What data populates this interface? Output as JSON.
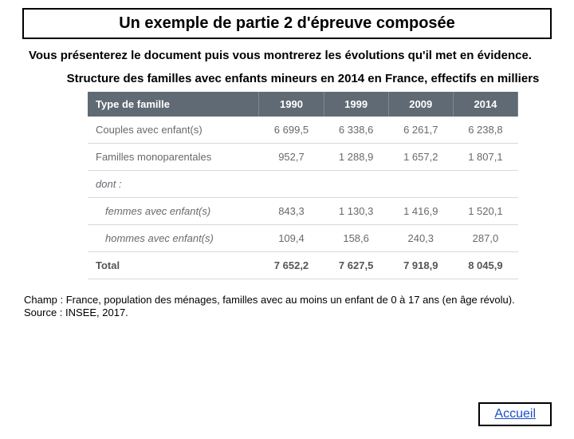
{
  "title": "Un exemple de partie 2 d'épreuve composée",
  "instruction": "Vous présenterez le document puis vous montrerez les évolutions qu'il met en évidence.",
  "caption": "Structure des familles avec enfants mineurs en 2014 en France, effectifs en milliers",
  "footnote_line1": "Champ : France, population des ménages, familles avec au moins un enfant de 0 à 17 ans (en âge révolu).",
  "footnote_line2": "Source : INSEE, 2017.",
  "home_link": "Accueil",
  "chart_data": {
    "type": "table",
    "headers": [
      "Type de famille",
      "1990",
      "1999",
      "2009",
      "2014"
    ],
    "rows": [
      {
        "label": "Couples avec enfant(s)",
        "v": [
          "6 699,5",
          "6 338,6",
          "6 261,7",
          "6 238,8"
        ],
        "style": "normal"
      },
      {
        "label": "Familles monoparentales",
        "v": [
          "952,7",
          "1 288,9",
          "1 657,2",
          "1 807,1"
        ],
        "style": "normal"
      },
      {
        "label": "dont :",
        "v": [
          "",
          "",
          "",
          ""
        ],
        "style": "dont"
      },
      {
        "label": "femmes avec enfant(s)",
        "v": [
          "843,3",
          "1 130,3",
          "1 416,9",
          "1 520,1"
        ],
        "style": "sub"
      },
      {
        "label": "hommes avec enfant(s)",
        "v": [
          "109,4",
          "158,6",
          "240,3",
          "287,0"
        ],
        "style": "sub"
      },
      {
        "label": "Total",
        "v": [
          "7 652,2",
          "7 627,5",
          "7 918,9",
          "8 045,9"
        ],
        "style": "total"
      }
    ]
  }
}
